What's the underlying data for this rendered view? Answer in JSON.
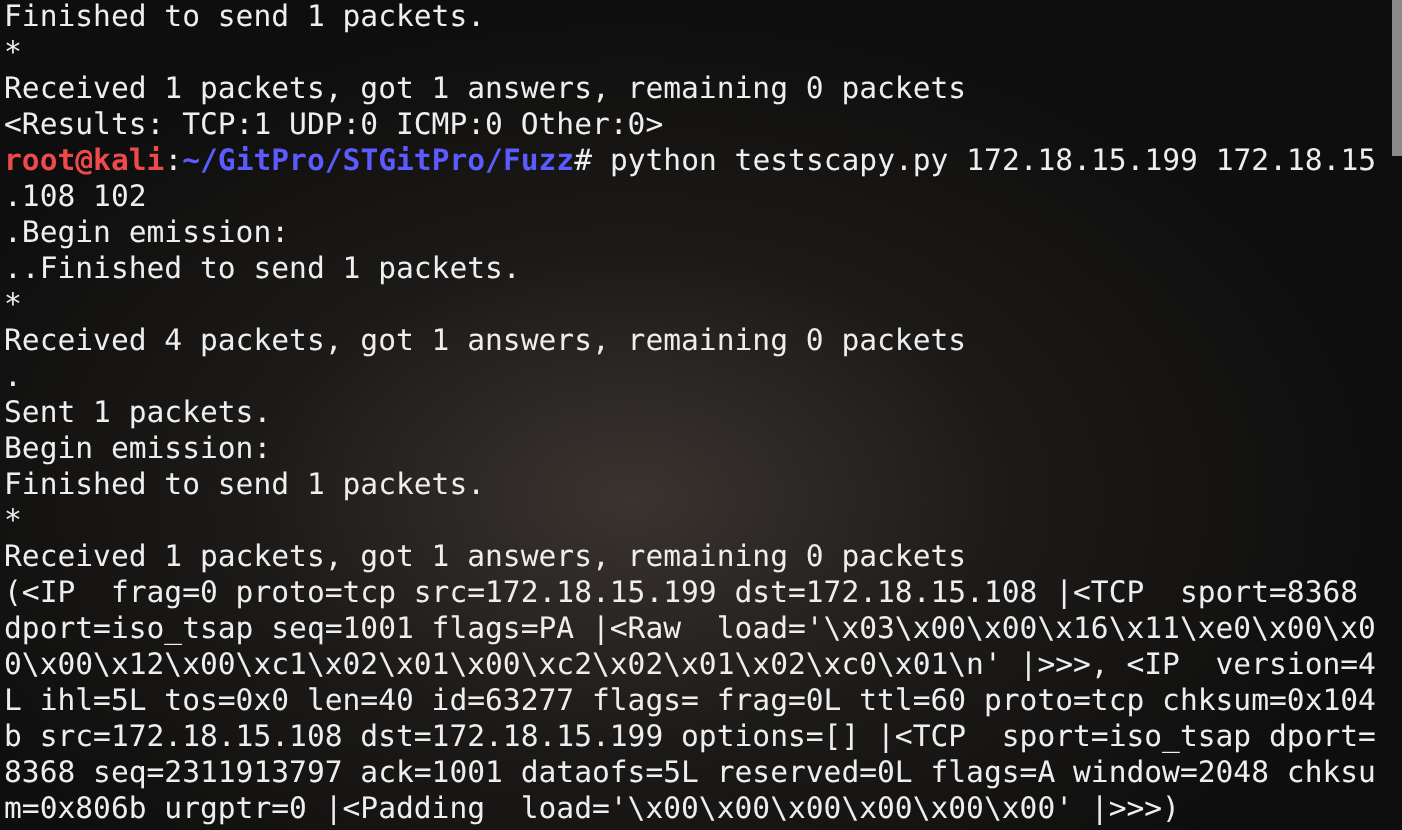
{
  "terminal": {
    "lines": [
      {
        "kind": "output",
        "text": "Finished to send 1 packets."
      },
      {
        "kind": "output",
        "text": "*"
      },
      {
        "kind": "output",
        "text": "Received 1 packets, got 1 answers, remaining 0 packets"
      },
      {
        "kind": "output",
        "text": "<Results: TCP:1 UDP:0 ICMP:0 Other:0>"
      },
      {
        "kind": "prompt",
        "user_host": "root@kali",
        "separator": ":",
        "path": "~/GitPro/STGitPro/Fuzz",
        "symbol": "#",
        "command": "python testscapy.py 172.18.15.199 172.18.15"
      },
      {
        "kind": "output",
        "text": ".108 102"
      },
      {
        "kind": "output",
        "text": ".Begin emission:"
      },
      {
        "kind": "output",
        "text": "..Finished to send 1 packets."
      },
      {
        "kind": "output",
        "text": "*"
      },
      {
        "kind": "output",
        "text": "Received 4 packets, got 1 answers, remaining 0 packets"
      },
      {
        "kind": "output",
        "text": "."
      },
      {
        "kind": "output",
        "text": "Sent 1 packets."
      },
      {
        "kind": "output",
        "text": "Begin emission:"
      },
      {
        "kind": "output",
        "text": "Finished to send 1 packets."
      },
      {
        "kind": "output",
        "text": "*"
      },
      {
        "kind": "output",
        "text": "Received 1 packets, got 1 answers, remaining 0 packets"
      },
      {
        "kind": "output",
        "text": "(<IP  frag=0 proto=tcp src=172.18.15.199 dst=172.18.15.108 |<TCP  sport=8368"
      },
      {
        "kind": "output",
        "text": "dport=iso_tsap seq=1001 flags=PA |<Raw  load='\\x03\\x00\\x00\\x16\\x11\\xe0\\x00\\x0"
      },
      {
        "kind": "output",
        "text": "0\\x00\\x12\\x00\\xc1\\x02\\x01\\x00\\xc2\\x02\\x01\\x02\\xc0\\x01\\n' |>>>, <IP  version=4"
      },
      {
        "kind": "output",
        "text": "L ihl=5L tos=0x0 len=40 id=63277 flags= frag=0L ttl=60 proto=tcp chksum=0x104"
      },
      {
        "kind": "output",
        "text": "b src=172.18.15.108 dst=172.18.15.199 options=[] |<TCP  sport=iso_tsap dport="
      },
      {
        "kind": "output",
        "text": "8368 seq=2311913797 ack=1001 dataofs=5L reserved=0L flags=A window=2048 chksu"
      },
      {
        "kind": "output",
        "text": "m=0x806b urgptr=0 |<Padding  load='\\x00\\x00\\x00\\x00\\x00\\x00' |>>>)"
      }
    ]
  }
}
